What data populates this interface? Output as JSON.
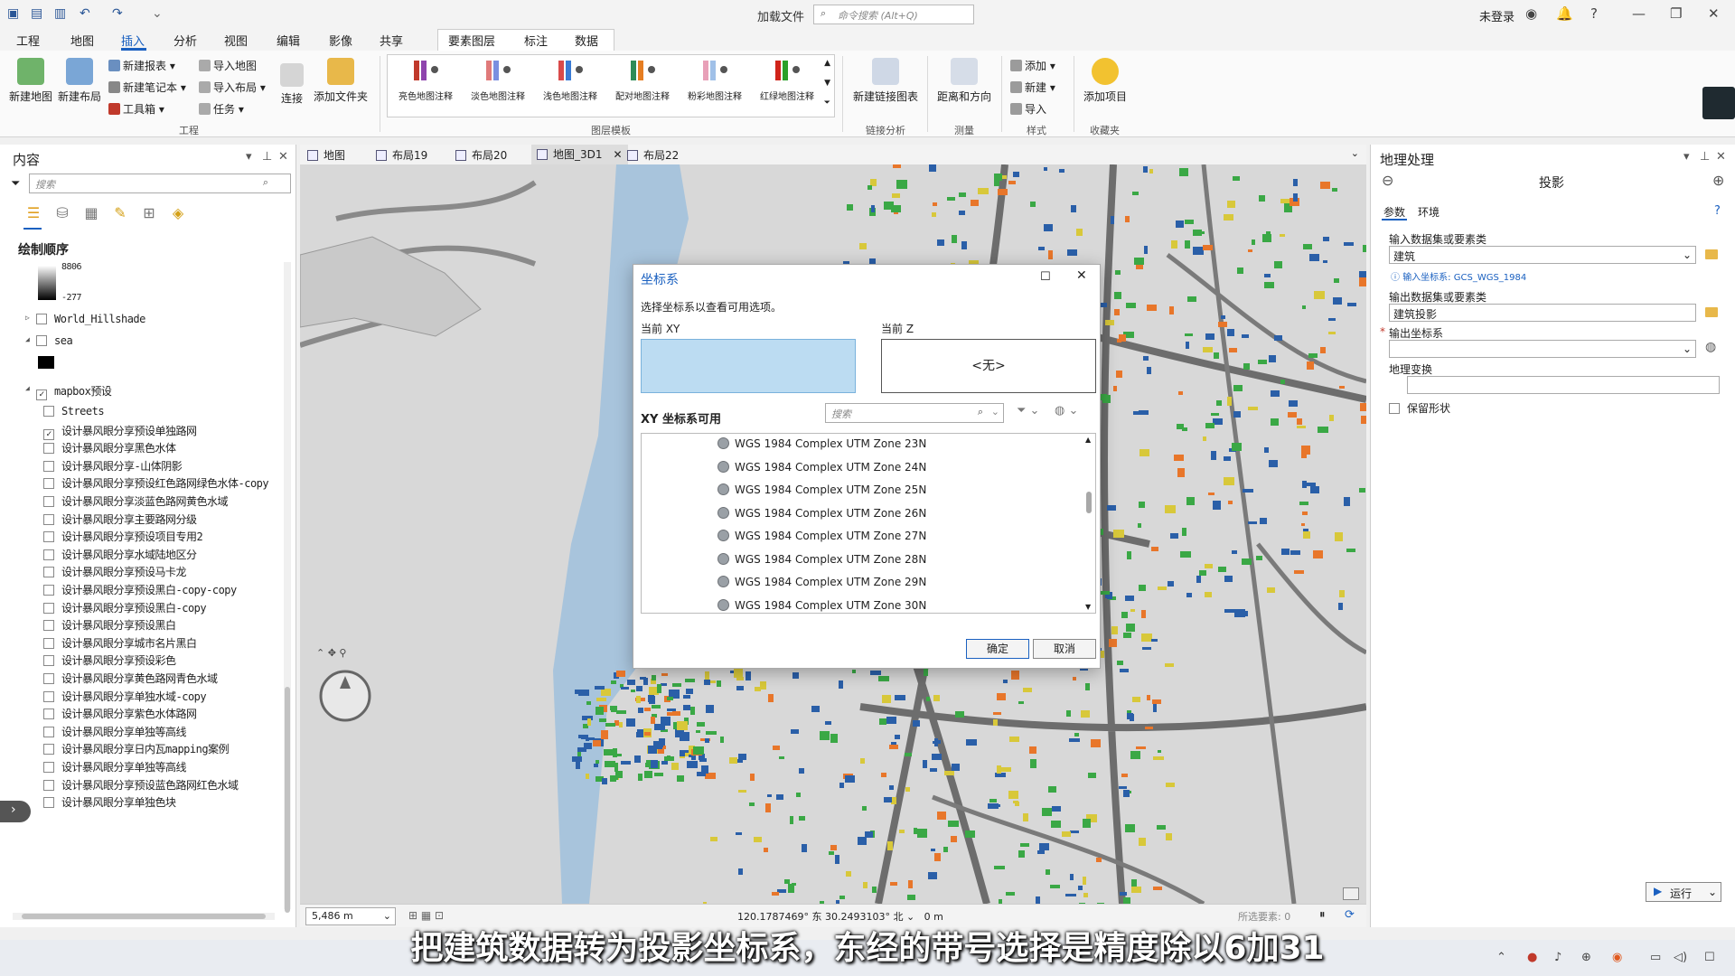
{
  "app": {
    "title": "加载文件",
    "command_search_placeholder": "命令搜索 (Alt+Q)",
    "user": "未登录"
  },
  "menu_tabs": [
    "工程",
    "地图",
    "插入",
    "分析",
    "视图",
    "编辑",
    "影像",
    "共享",
    "要素图层",
    "标注",
    "数据"
  ],
  "active_menu_tab": "插入",
  "ribbon": {
    "project_group": {
      "label": "工程",
      "new_map": "新建地图",
      "new_layout": "新建布局",
      "new_report": "新建报表",
      "new_notebook": "新建笔记本",
      "toolbox": "工具箱",
      "import_map": "导入地图",
      "import_layout": "导入布局",
      "task": "任务",
      "connect": "连接",
      "add_folder": "添加文件夹"
    },
    "templates_group": {
      "label": "图层模板",
      "items": [
        "亮色地图注释",
        "淡色地图注释",
        "浅色地图注释",
        "配对地图注释",
        "粉彩地图注释",
        "红绿地图注释"
      ]
    },
    "link_group": {
      "label": "链接分析",
      "new_link_chart": "新建链接图表"
    },
    "measure_group": {
      "label": "测量",
      "distance_direction": "距离和方向"
    },
    "style_group": {
      "label": "样式",
      "add": "添加",
      "new": "新建",
      "import": "导入"
    },
    "favorites_group": {
      "label": "收藏夹",
      "add_item": "添加项目"
    }
  },
  "contents": {
    "title": "内容",
    "search_placeholder": "搜索",
    "draw_order": "绘制顺序",
    "legend_max": "8806",
    "legend_min": "-277",
    "layers": [
      {
        "name": "World_Hillshade",
        "checked": false,
        "expander": true
      },
      {
        "name": "sea",
        "checked": false,
        "expander": true
      },
      {
        "name": "mapbox预设",
        "checked": true,
        "expander": true
      },
      {
        "name": "Streets",
        "checked": false
      },
      {
        "name": "设计暴风眼分享预设单独路网",
        "checked": true
      },
      {
        "name": "设计暴风眼分享黑色水体",
        "checked": false
      },
      {
        "name": "设计暴风眼分享-山体阴影",
        "checked": false
      },
      {
        "name": "设计暴风眼分享预设红色路网绿色水体-copy",
        "checked": false
      },
      {
        "name": "设计暴风眼分享淡蓝色路网黄色水域",
        "checked": false
      },
      {
        "name": "设计暴风眼分享主要路网分级",
        "checked": false
      },
      {
        "name": "设计暴风眼分享预设项目专用2",
        "checked": false
      },
      {
        "name": "设计暴风眼分享水域陆地区分",
        "checked": false
      },
      {
        "name": "设计暴风眼分享预设马卡龙",
        "checked": false
      },
      {
        "name": "设计暴风眼分享预设黑白-copy-copy",
        "checked": false
      },
      {
        "name": "设计暴风眼分享预设黑白-copy",
        "checked": false
      },
      {
        "name": "设计暴风眼分享预设黑白",
        "checked": false
      },
      {
        "name": "设计暴风眼分享城市名片黑白",
        "checked": false
      },
      {
        "name": "设计暴风眼分享预设彩色",
        "checked": false
      },
      {
        "name": "设计暴风眼分享黄色路网青色水域",
        "checked": false
      },
      {
        "name": "设计暴风眼分享单独水域-copy",
        "checked": false
      },
      {
        "name": "设计暴风眼分享紫色水体路网",
        "checked": false
      },
      {
        "name": "设计暴风眼分享单独等高线",
        "checked": false
      },
      {
        "name": "设计暴风眼分享日内瓦mapping案例",
        "checked": false
      },
      {
        "name": "设计暴风眼分享单独等高线",
        "checked": false
      },
      {
        "name": "设计暴风眼分享预设蓝色路网红色水域",
        "checked": false
      },
      {
        "name": "设计暴风眼分享单独色块",
        "checked": false
      }
    ]
  },
  "view_tabs": [
    {
      "label": "地图",
      "active": false
    },
    {
      "label": "布局19",
      "active": false
    },
    {
      "label": "布局20",
      "active": false
    },
    {
      "label": "地图_3D1",
      "active": true
    },
    {
      "label": "布局22",
      "active": false
    }
  ],
  "map_status": {
    "scale": "5,486 m",
    "coords": "120.1787469° 东  30.2493103° 北",
    "elevation": "0 m",
    "selected_features": "所选要素: 0"
  },
  "geoprocessing": {
    "title": "地理处理",
    "tool": "投影",
    "tabs": [
      "参数",
      "环境"
    ],
    "input_label": "输入数据集或要素类",
    "input_value": "建筑",
    "input_cs_info": "输入坐标系: GCS_WGS_1984",
    "output_label": "输出数据集或要素类",
    "output_value": "建筑投影",
    "output_cs_label": "输出坐标系",
    "geo_transform_label": "地理变换",
    "preserve_shape": "保留形状",
    "run": "运行"
  },
  "dialog": {
    "title": "坐标系",
    "hint": "选择坐标系以查看可用选项。",
    "current_xy": "当前 XY",
    "current_z": "当前 Z",
    "current_z_value": "<无>",
    "xy_available": "XY 坐标系可用",
    "search_placeholder": "搜索",
    "items": [
      "WGS 1984 Complex UTM Zone 23N",
      "WGS 1984 Complex UTM Zone 24N",
      "WGS 1984 Complex UTM Zone 25N",
      "WGS 1984 Complex UTM Zone 26N",
      "WGS 1984 Complex UTM Zone 27N",
      "WGS 1984 Complex UTM Zone 28N",
      "WGS 1984 Complex UTM Zone 29N",
      "WGS 1984 Complex UTM Zone 30N"
    ],
    "ok": "确定",
    "cancel": "取消"
  },
  "subtitle": "把建筑数据转为投影坐标系，东经的带号选择是精度除以6加31",
  "colors": {
    "accent": "#1a60c0",
    "water": "#a8c4dc",
    "building_green": "#3aa845",
    "building_blue": "#2a5fa8",
    "building_orange": "#e8762a",
    "building_yellow": "#d8c83a"
  }
}
